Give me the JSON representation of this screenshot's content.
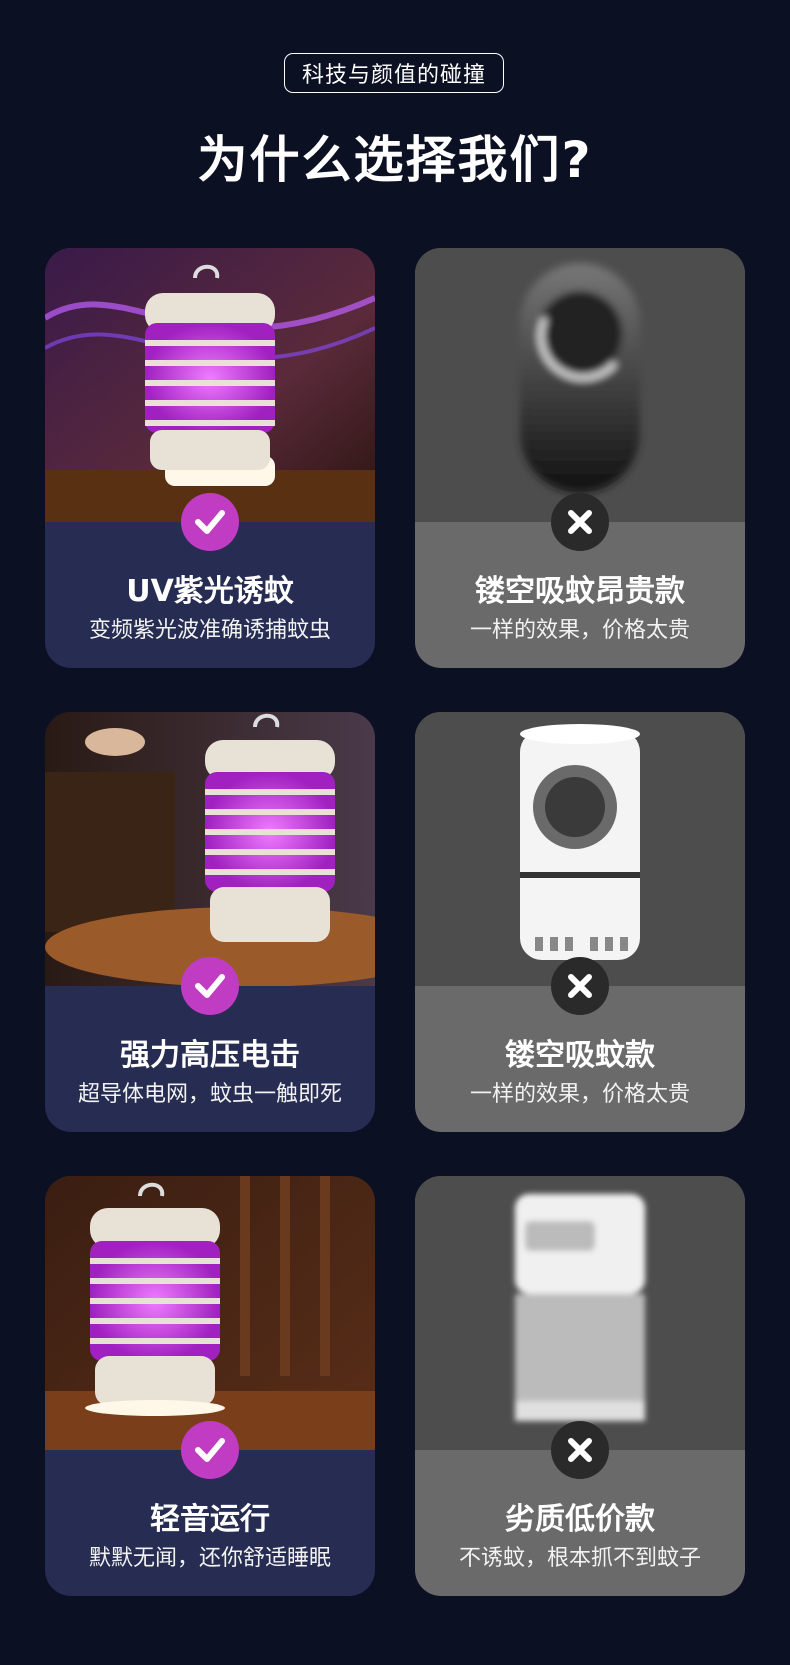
{
  "header": {
    "badge": "科技与颜值的碰撞",
    "title": "为什么选择我们?"
  },
  "colors": {
    "background": "#0c1023",
    "good_card": "#262c52",
    "bad_card": "#6a6a6a",
    "check_accent": "#c03dc3"
  },
  "rows": [
    {
      "ours": {
        "title": "UV紫光诱蚊",
        "subtitle": "变频紫光波准确诱捕蚊虫",
        "icon": "check-icon"
      },
      "theirs": {
        "title": "镂空吸蚊昂贵款",
        "subtitle": "一样的效果，价格太贵",
        "icon": "x-icon"
      }
    },
    {
      "ours": {
        "title": "强力高压电击",
        "subtitle": "超导体电网，蚊虫一触即死",
        "icon": "check-icon"
      },
      "theirs": {
        "title": "镂空吸蚊款",
        "subtitle": "一样的效果，价格太贵",
        "icon": "x-icon"
      }
    },
    {
      "ours": {
        "title": "轻音运行",
        "subtitle": "默默无闻，还你舒适睡眠",
        "icon": "check-icon"
      },
      "theirs": {
        "title": "劣质低价款",
        "subtitle": "不诱蚊，根本抓不到蚊子",
        "icon": "x-icon"
      }
    }
  ]
}
